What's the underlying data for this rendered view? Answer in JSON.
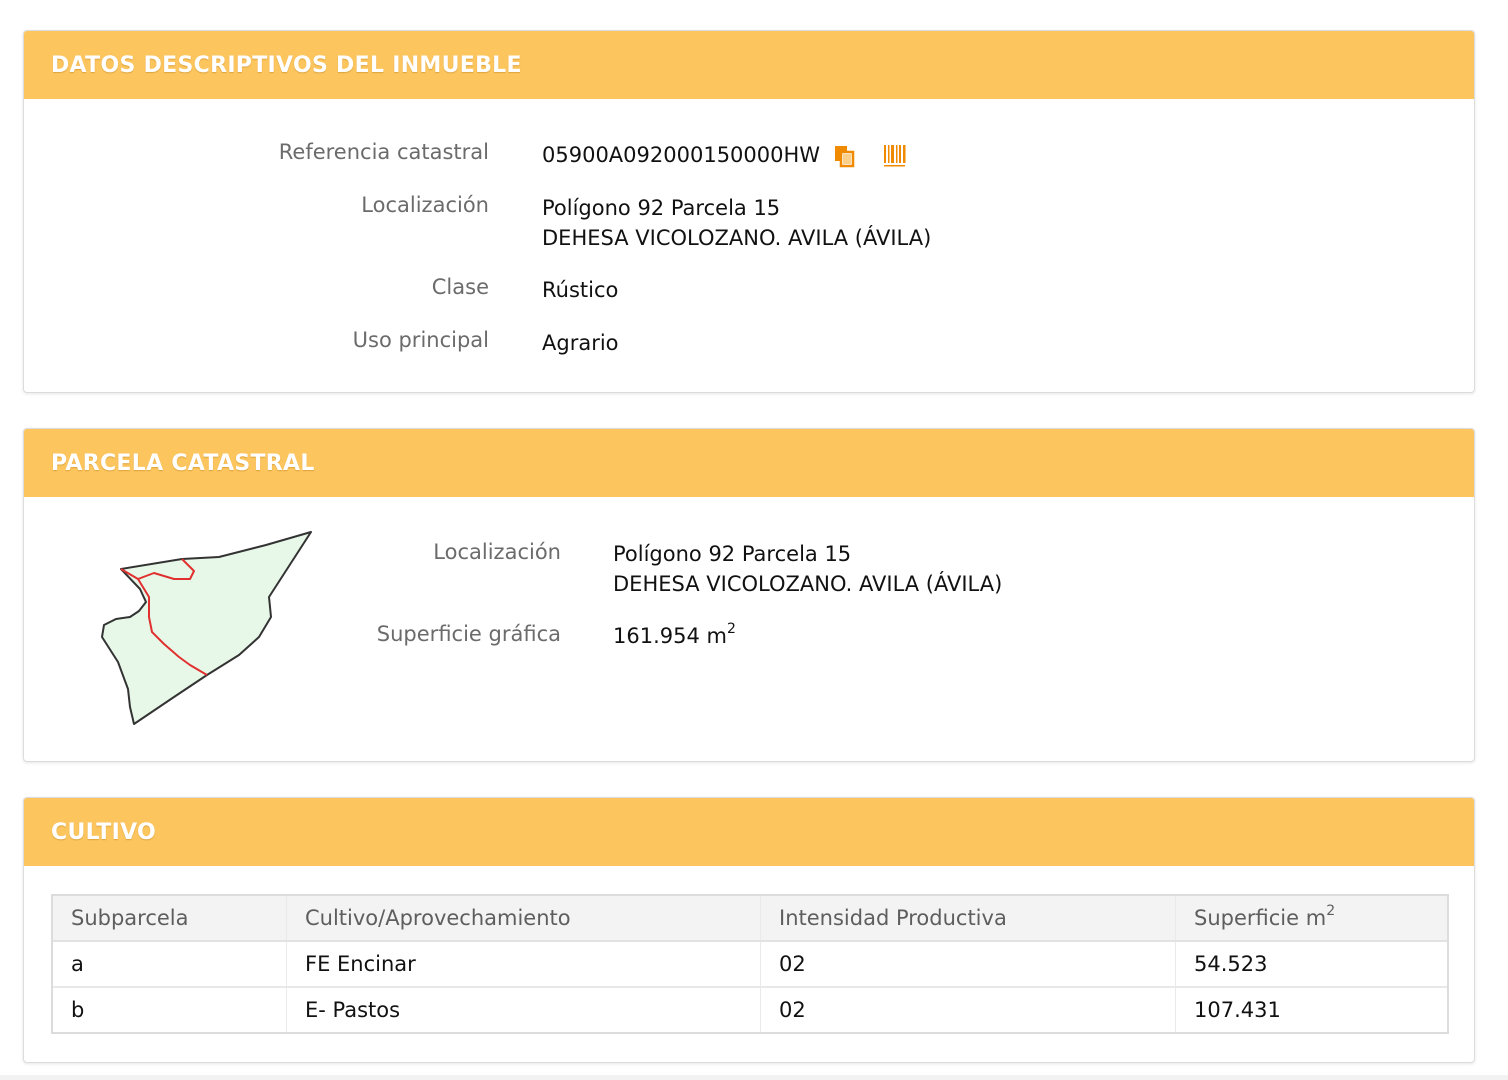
{
  "colors": {
    "header_bg": "#fdc55e",
    "header_text": "#ffffff",
    "label_text": "#6b6b6b",
    "value_text": "#111111",
    "accent_icon": "#f08a00",
    "parcel_fill": "#e8f8e8",
    "parcel_outline": "#333333",
    "subparcel_line": "#e03030"
  },
  "inmueble": {
    "title": "DATOS DESCRIPTIVOS DEL INMUEBLE",
    "fields": [
      {
        "label": "Referencia catastral",
        "value": "05900A092000150000HW"
      },
      {
        "label": "Localización",
        "value_line1": "Polígono 92 Parcela 15",
        "value_line2": "DEHESA VICOLOZANO. AVILA (ÁVILA)"
      },
      {
        "label": "Clase",
        "value": "Rústico"
      },
      {
        "label": "Uso principal",
        "value": "Agrario"
      }
    ],
    "icons": [
      "copy-icon",
      "barcode-icon"
    ]
  },
  "parcela": {
    "title": "PARCELA CATASTRAL",
    "localizacion_label": "Localización",
    "localizacion_line1": "Polígono 92 Parcela 15",
    "localizacion_line2": "DEHESA VICOLOZANO. AVILA (ÁVILA)",
    "superficie_label": "Superficie gráfica",
    "superficie_value": "161.954 m",
    "superficie_exp": "2"
  },
  "cultivo": {
    "title": "CULTIVO",
    "headers": {
      "subparcela": "Subparcela",
      "cultivo": "Cultivo/Aprovechamiento",
      "intensidad": "Intensidad Productiva",
      "superficie": "Superficie m",
      "superficie_exp": "2"
    },
    "rows": [
      {
        "subparcela": "a",
        "cultivo": "FE Encinar",
        "intensidad": "02",
        "superficie": "54.523"
      },
      {
        "subparcela": "b",
        "cultivo": "E- Pastos",
        "intensidad": "02",
        "superficie": "107.431"
      }
    ]
  }
}
